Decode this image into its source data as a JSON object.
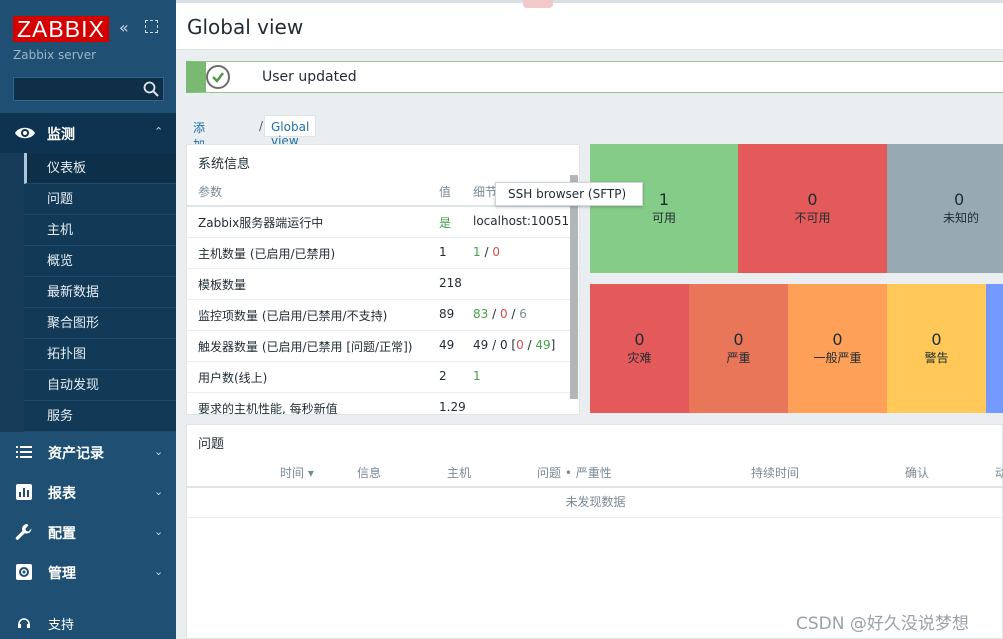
{
  "sidebar": {
    "logo": "ZABBIX",
    "server_name": "Zabbix server",
    "search": {
      "placeholder": ""
    },
    "monitoring": {
      "label": "监测",
      "items": [
        {
          "label": "仪表板"
        },
        {
          "label": "问题"
        },
        {
          "label": "主机"
        },
        {
          "label": "概览"
        },
        {
          "label": "最新数据"
        },
        {
          "label": "聚合图形"
        },
        {
          "label": "拓扑图"
        },
        {
          "label": "自动发现"
        },
        {
          "label": "服务"
        }
      ]
    },
    "sections": [
      {
        "label": "资产记录",
        "icon": "list-icon"
      },
      {
        "label": "报表",
        "icon": "bar-chart-icon"
      },
      {
        "label": "配置",
        "icon": "wrench-icon"
      },
      {
        "label": "管理",
        "icon": "gear-icon"
      }
    ],
    "support": {
      "label": "支持"
    }
  },
  "header": {
    "title": "Global view"
  },
  "message": {
    "text": "User updated"
  },
  "breadcrumb": {
    "link": "添加仪表盘",
    "sep": "/",
    "current": "Global view"
  },
  "tooltip": {
    "text": "SSH browser (SFTP)"
  },
  "system_info": {
    "title": "系统信息",
    "columns": {
      "param": "参数",
      "value": "值",
      "details": "细节"
    },
    "rows": [
      {
        "param": "Zabbix服务器端运行中",
        "value": "是",
        "details": "localhost:10051"
      },
      {
        "param": "主机数量 (已启用/已禁用)",
        "value": "1",
        "d1": "1",
        "d2": "0"
      },
      {
        "param": "模板数量",
        "value": "218"
      },
      {
        "param": "监控项数量 (已启用/已禁用/不支持)",
        "value": "89",
        "d1": "83",
        "d2": "0",
        "d3": "6"
      },
      {
        "param": "触发器数量 (已启用/已禁用 [问题/正常])",
        "value": "49",
        "d0": "49 / 0 [",
        "d1": "0",
        "d2": "49",
        "d3": "]"
      },
      {
        "param": "用户数(线上)",
        "value": "2",
        "d1": "1"
      },
      {
        "param": "要求的主机性能, 每秒新值",
        "value": "1.29"
      }
    ]
  },
  "host_availability": [
    {
      "count": "1",
      "label": "可用",
      "color": "#86cc89"
    },
    {
      "count": "0",
      "label": "不可用",
      "color": "#e45959"
    },
    {
      "count": "0",
      "label": "未知的",
      "color": "#97aab3"
    }
  ],
  "problems_by_severity": [
    {
      "count": "0",
      "label": "灾难",
      "color": "#e45959"
    },
    {
      "count": "0",
      "label": "严重",
      "color": "#e97659"
    },
    {
      "count": "0",
      "label": "一般严重",
      "color": "#ffa059"
    },
    {
      "count": "0",
      "label": "警告",
      "color": "#ffc859"
    }
  ],
  "problems": {
    "title": "问题",
    "columns": [
      "时间 ▾",
      "信息",
      "主机",
      "问题 • 严重性",
      "持续时间",
      "确认",
      "动"
    ],
    "empty": "未发现数据"
  },
  "watermark": "CSDN @好久没说梦想"
}
